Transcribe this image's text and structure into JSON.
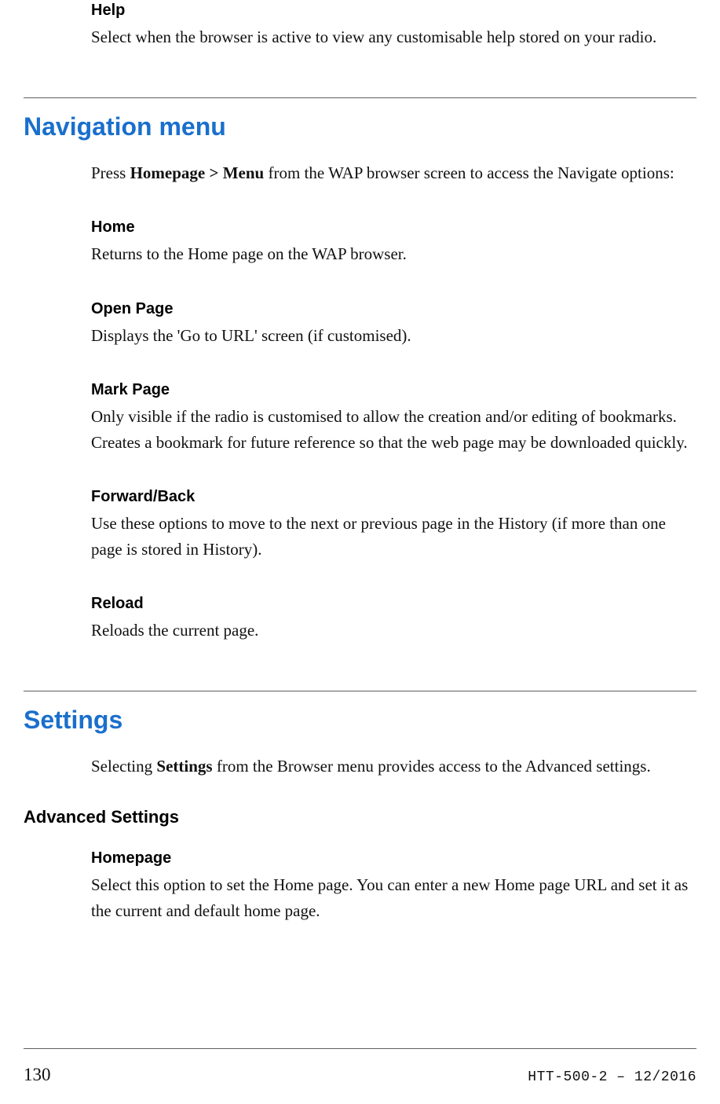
{
  "help": {
    "title": "Help",
    "desc": "Select when the browser is active to view any customisable help stored on your radio."
  },
  "nav": {
    "heading": "Navigation menu",
    "intro_pre": "Press ",
    "intro_bold": "Homepage > Menu",
    "intro_post": " from the WAP browser screen to access the Navigate options:",
    "items": [
      {
        "title": "Home",
        "desc": "Returns to the Home page on the WAP browser."
      },
      {
        "title": "Open Page",
        "desc": "Displays the 'Go to URL' screen (if customised)."
      },
      {
        "title": "Mark Page",
        "desc": "Only visible if the radio is customised to allow the creation and/or editing of bookmarks. Creates a bookmark for future reference so that the web page may be downloaded quickly."
      },
      {
        "title": "Forward/Back",
        "desc": "Use these options to move to the next or previous page in the History (if more than one page is stored in History)."
      },
      {
        "title": "Reload",
        "desc": "Reloads the current page."
      }
    ]
  },
  "settings": {
    "heading": "Settings",
    "intro_pre": "Selecting ",
    "intro_bold": "Settings",
    "intro_post": " from the Browser menu provides access to the Advanced settings.",
    "advanced_heading": "Advanced Settings",
    "homepage": {
      "title": "Homepage",
      "desc": "Select this option to set the Home page. You can enter a new Home page URL and set it as the current and default home page."
    }
  },
  "footer": {
    "page": "130",
    "docid": "HTT-500-2 – 12/2016"
  }
}
